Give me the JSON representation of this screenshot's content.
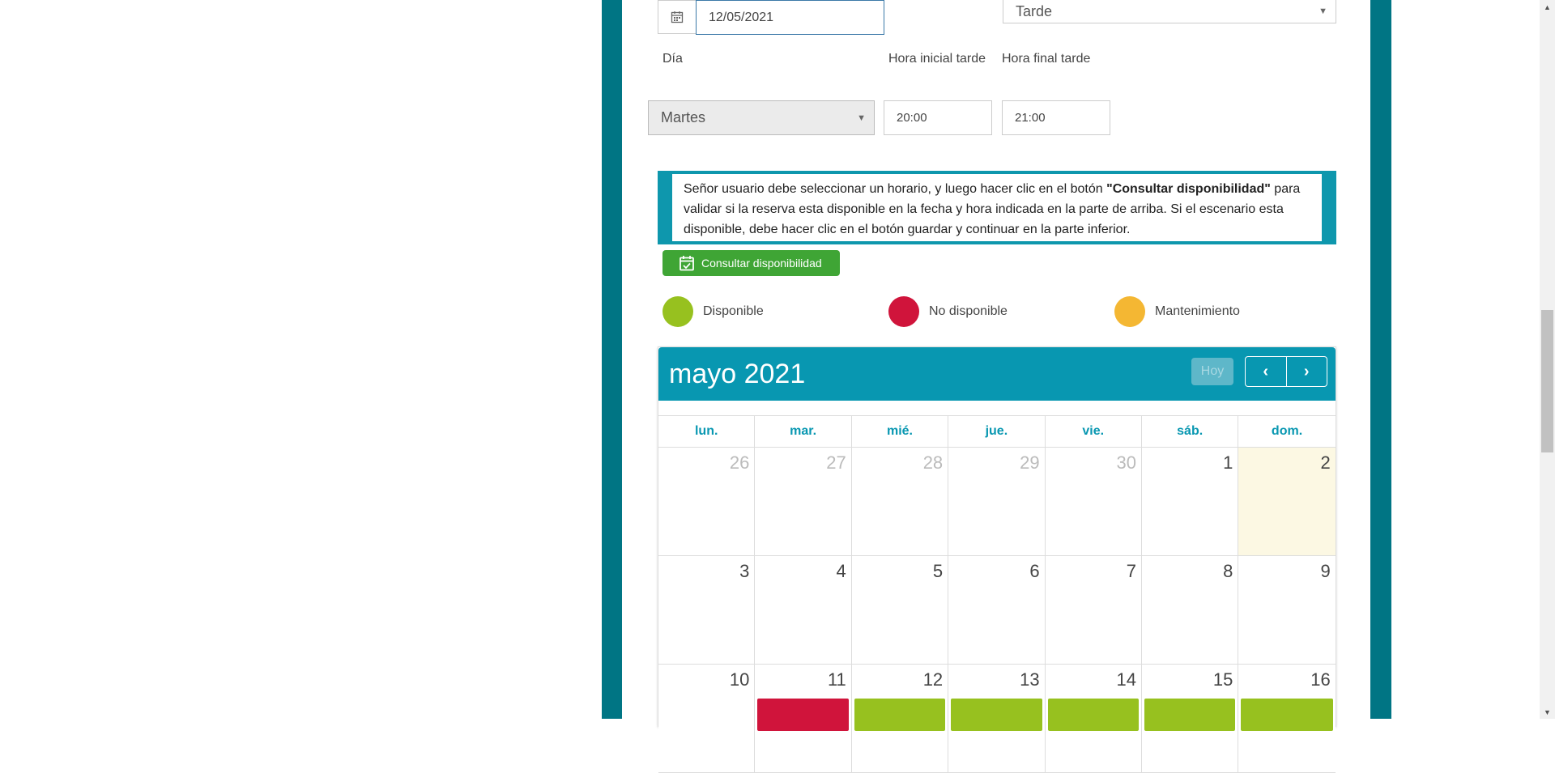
{
  "form": {
    "date_value": "12/05/2021",
    "turno_value": "Tarde",
    "labels": {
      "dia": "Día",
      "hora_inicial": "Hora inicial tarde",
      "hora_final": "Hora final tarde"
    },
    "dia_value": "Martes",
    "hora_inicial_value": "20:00",
    "hora_final_value": "21:00"
  },
  "notice": {
    "text_before": "Señor usuario debe seleccionar un horario, y luego hacer clic en el botón ",
    "bold": "\"Consultar disponibilidad\"",
    "text_after": " para validar si la reserva esta disponible en la fecha y hora indicada en la parte de arriba. Si el escenario esta disponible, debe hacer clic en el botón guardar y continuar en la parte inferior."
  },
  "consultar_button": {
    "label": "Consultar disponibilidad",
    "icon": "calendar-check-icon"
  },
  "legend": [
    {
      "label": "Disponible",
      "color": "#97c11f"
    },
    {
      "label": "No disponible",
      "color": "#d0143b"
    },
    {
      "label": "Mantenimiento",
      "color": "#f4b733"
    }
  ],
  "calendar": {
    "title": "mayo 2021",
    "today_label": "Hoy",
    "prev_icon": "chevron-left-icon",
    "next_icon": "chevron-right-icon",
    "header_color": "#0897b1",
    "days_of_week": [
      "lun.",
      "mar.",
      "mié.",
      "jue.",
      "vie.",
      "sáb.",
      "dom."
    ],
    "weeks": [
      [
        {
          "n": "26",
          "other": true
        },
        {
          "n": "27",
          "other": true
        },
        {
          "n": "28",
          "other": true
        },
        {
          "n": "29",
          "other": true
        },
        {
          "n": "30",
          "other": true
        },
        {
          "n": "1"
        },
        {
          "n": "2",
          "today": true
        }
      ],
      [
        {
          "n": "3"
        },
        {
          "n": "4"
        },
        {
          "n": "5"
        },
        {
          "n": "6"
        },
        {
          "n": "7"
        },
        {
          "n": "8"
        },
        {
          "n": "9"
        }
      ],
      [
        {
          "n": "10"
        },
        {
          "n": "11",
          "event": "No disponible"
        },
        {
          "n": "12",
          "event": "Disponible"
        },
        {
          "n": "13",
          "event": "Disponible"
        },
        {
          "n": "14",
          "event": "Disponible"
        },
        {
          "n": "15",
          "event": "Disponible"
        },
        {
          "n": "16",
          "event": "Disponible"
        }
      ]
    ]
  },
  "colors": {
    "frame": "#007584",
    "notice_border": "#0e97ad",
    "button_green": "#3fa535"
  }
}
